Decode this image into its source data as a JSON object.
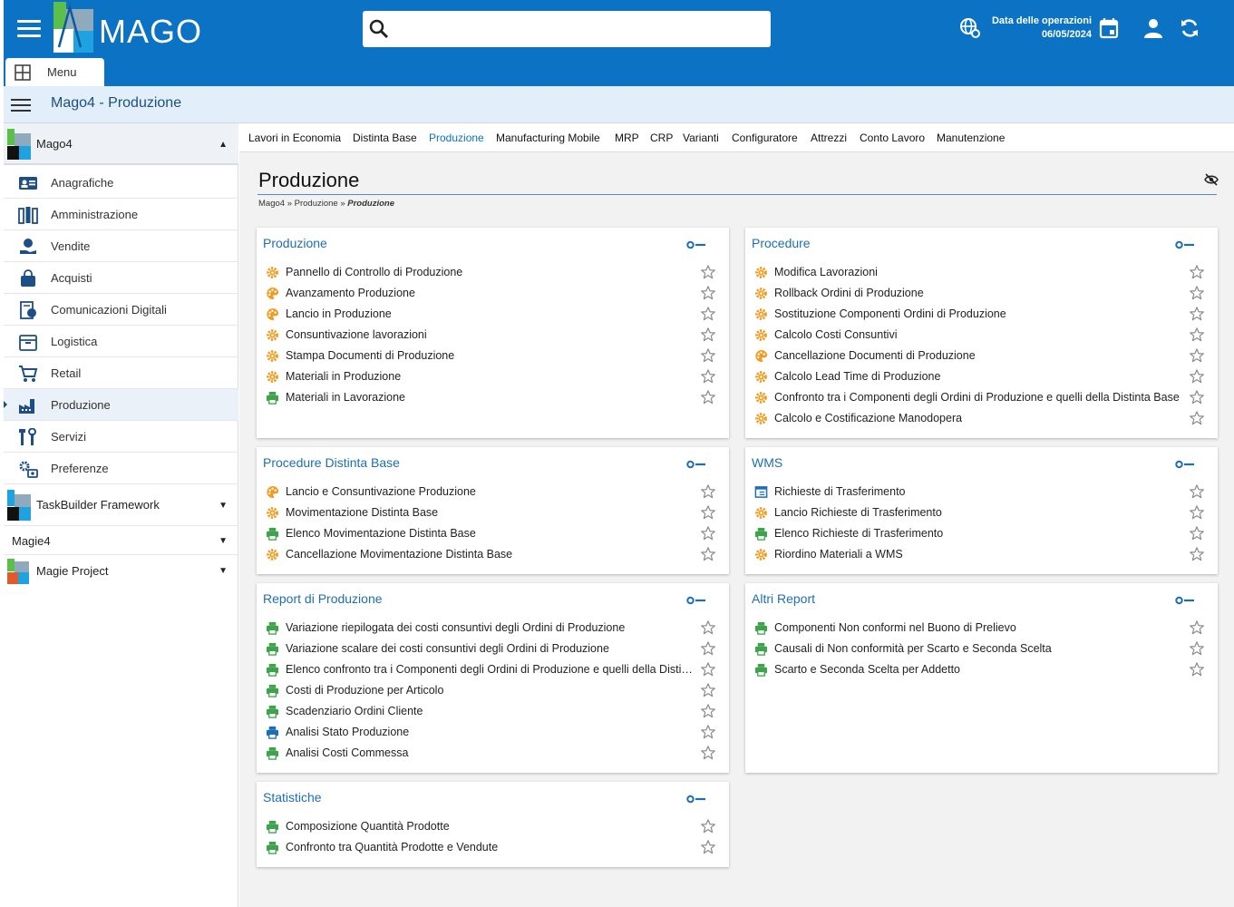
{
  "header": {
    "logo_text": "MAGO",
    "search_placeholder": "",
    "operation_date_label": "Data delle operazioni",
    "operation_date_value": "06/05/2024",
    "menu_tab_label": "Menu"
  },
  "subheader": {
    "title": "Mago4 - Produzione"
  },
  "sidebar": {
    "top_group": "Mago4",
    "items": [
      {
        "label": "Anagrafiche",
        "icon": "id-card-icon"
      },
      {
        "label": "Amministrazione",
        "icon": "ledger-icon"
      },
      {
        "label": "Vendite",
        "icon": "hand-money-icon"
      },
      {
        "label": "Acquisti",
        "icon": "shopping-bag-icon"
      },
      {
        "label": "Comunicazioni Digitali",
        "icon": "digital-doc-icon"
      },
      {
        "label": "Logistica",
        "icon": "box-icon"
      },
      {
        "label": "Retail",
        "icon": "cart-icon"
      },
      {
        "label": "Produzione",
        "icon": "factory-icon"
      },
      {
        "label": "Servizi",
        "icon": "tools-icon"
      },
      {
        "label": "Preferenze",
        "icon": "gears-icon"
      }
    ],
    "groups": [
      "TaskBuilder Framework",
      "Magie4",
      "Magie Project"
    ]
  },
  "tabs": [
    "Lavori in Economia",
    "Distinta Base",
    "Produzione",
    "Manufacturing Mobile",
    "MRP",
    "CRP",
    "Varianti",
    "Configuratore",
    "Attrezzi",
    "Conto Lavoro",
    "Manutenzione"
  ],
  "active_tab": "Produzione",
  "page": {
    "title": "Produzione",
    "breadcrumb": [
      "Mago4",
      "Produzione",
      "Produzione"
    ]
  },
  "cards": {
    "produzione": {
      "title": "Produzione",
      "items": [
        {
          "label": "Pannello di Controllo di Produzione",
          "icon": "gear"
        },
        {
          "label": "Avanzamento Produzione",
          "icon": "palette"
        },
        {
          "label": "Lancio in Produzione",
          "icon": "palette"
        },
        {
          "label": "Consuntivazione lavorazioni",
          "icon": "gear"
        },
        {
          "label": "Stampa Documenti di Produzione",
          "icon": "gear"
        },
        {
          "label": "Materiali in Produzione",
          "icon": "gear"
        },
        {
          "label": "Materiali in Lavorazione",
          "icon": "printer"
        }
      ]
    },
    "procedure": {
      "title": "Procedure",
      "items": [
        {
          "label": "Modifica Lavorazioni",
          "icon": "gear"
        },
        {
          "label": "Rollback Ordini di Produzione",
          "icon": "gear"
        },
        {
          "label": "Sostituzione Componenti Ordini di Produzione",
          "icon": "gear"
        },
        {
          "label": "Calcolo Costi Consuntivi",
          "icon": "gear"
        },
        {
          "label": "Cancellazione Documenti di Produzione",
          "icon": "palette"
        },
        {
          "label": "Calcolo Lead Time di Produzione",
          "icon": "gear"
        },
        {
          "label": "Confronto tra i Componenti degli Ordini di Produzione e quelli della Distinta Base",
          "icon": "gear"
        },
        {
          "label": "Calcolo e Costificazione Manodopera",
          "icon": "gear"
        }
      ]
    },
    "procedure_distinta": {
      "title": "Procedure Distinta Base",
      "items": [
        {
          "label": "Lancio e Consuntivazione Produzione",
          "icon": "palette"
        },
        {
          "label": "Movimentazione Distinta Base",
          "icon": "gear"
        },
        {
          "label": "Elenco Movimentazione Distinta Base",
          "icon": "printer"
        },
        {
          "label": "Cancellazione Movimentazione Distinta Base",
          "icon": "gear"
        }
      ]
    },
    "wms": {
      "title": "WMS",
      "items": [
        {
          "label": "Richieste di Trasferimento",
          "icon": "window"
        },
        {
          "label": "Lancio Richieste di Trasferimento",
          "icon": "gear"
        },
        {
          "label": "Elenco Richieste di Trasferimento",
          "icon": "printer"
        },
        {
          "label": "Riordino Materiali a WMS",
          "icon": "gear"
        }
      ]
    },
    "report_produzione": {
      "title": "Report di Produzione",
      "items": [
        {
          "label": "Variazione riepilogata dei costi consuntivi degli Ordini di Produzione",
          "icon": "printer"
        },
        {
          "label": "Variazione scalare dei costi consuntivi degli Ordini di Produzione",
          "icon": "printer"
        },
        {
          "label": "Elenco confronto tra i Componenti degli Ordini di Produzione e quelli della Distinta Base",
          "icon": "printer"
        },
        {
          "label": "Costi di Produzione per Articolo",
          "icon": "printer"
        },
        {
          "label": "Scadenziario Ordini Cliente",
          "icon": "printer"
        },
        {
          "label": "Analisi Stato Produzione",
          "icon": "printer-blue"
        },
        {
          "label": "Analisi Costi Commessa",
          "icon": "printer"
        }
      ]
    },
    "altri_report": {
      "title": "Altri Report",
      "items": [
        {
          "label": "Componenti Non conformi nel Buono di Prelievo",
          "icon": "printer"
        },
        {
          "label": "Causali di Non conformità per Scarto e Seconda Scelta",
          "icon": "printer"
        },
        {
          "label": "Scarto e Seconda Scelta per Addetto",
          "icon": "printer"
        }
      ]
    },
    "statistiche": {
      "title": "Statistiche",
      "items": [
        {
          "label": "Composizione Quantità Prodotte",
          "icon": "printer"
        },
        {
          "label": "Confronto tra Quantità Prodotte e Vendute",
          "icon": "printer"
        }
      ]
    }
  },
  "colors": {
    "brand": "#0b72c4",
    "gear": "#f29c1f",
    "printer": "#3fa34d",
    "link": "#1e6eb5"
  }
}
